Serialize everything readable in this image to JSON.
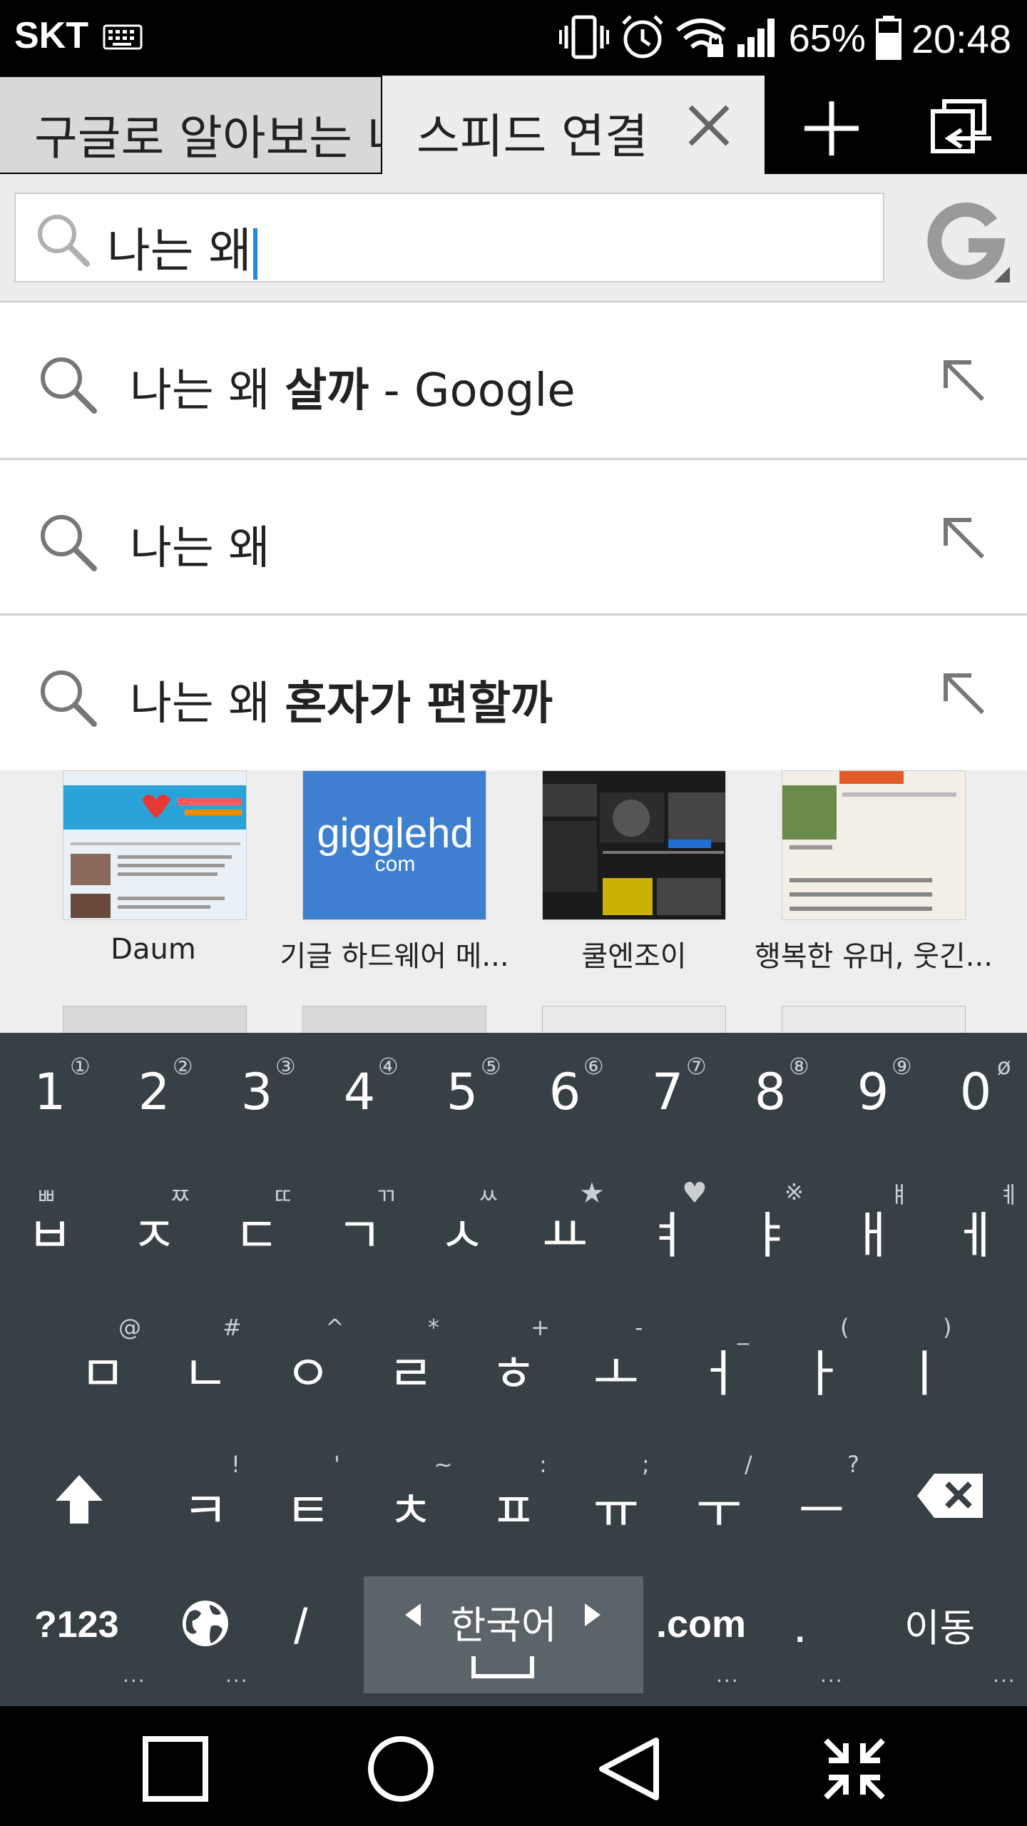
{
  "status_bar": {
    "carrier": "SKT",
    "battery_percent": "65%",
    "clock": "20:48",
    "icons": [
      "keyboard-icon",
      "vibrate-icon",
      "alarm-icon",
      "wifi-locked-icon",
      "signal-icon",
      "battery-icon"
    ]
  },
  "tabs": {
    "inactive_label": "구글로 알아보는 나",
    "active_label": "스피드 연결",
    "icons": [
      "close-icon",
      "plus-icon",
      "tab-manager-icon"
    ]
  },
  "address_bar": {
    "value": "나는 왜",
    "icons": [
      "search-icon",
      "google-g-icon"
    ]
  },
  "suggestions": [
    {
      "prefix": "나는 왜 ",
      "bold": "살까",
      "suffix": " - Google"
    },
    {
      "prefix": "나는 왜",
      "bold": "",
      "suffix": ""
    },
    {
      "prefix": "나는 왜 ",
      "bold": "혼자가 편할까",
      "suffix": ""
    }
  ],
  "speed_dial": {
    "tiles": [
      {
        "label": "Daum",
        "color": "#e9f1f7"
      },
      {
        "label": "기글 하드웨어 메...",
        "color": "#3f7fd0",
        "logo_text": "gigglehd",
        "logo_sub": "com"
      },
      {
        "label": "쿨엔조이",
        "color": "#1b1b1b"
      },
      {
        "label": "행복한 유머, 웃긴...",
        "color": "#f4efe6"
      }
    ]
  },
  "keyboard": {
    "number_row": [
      {
        "key": "1",
        "sup": "①"
      },
      {
        "key": "2",
        "sup": "②"
      },
      {
        "key": "3",
        "sup": "③"
      },
      {
        "key": "4",
        "sup": "④"
      },
      {
        "key": "5",
        "sup": "⑤"
      },
      {
        "key": "6",
        "sup": "⑥"
      },
      {
        "key": "7",
        "sup": "⑦"
      },
      {
        "key": "8",
        "sup": "⑧"
      },
      {
        "key": "9",
        "sup": "⑨"
      },
      {
        "key": "0",
        "sup": "ø"
      }
    ],
    "row1": [
      {
        "key": "ㅂ",
        "sup": "ㅃ"
      },
      {
        "key": "ㅈ",
        "sup": "ㅉ"
      },
      {
        "key": "ㄷ",
        "sup": "ㄸ"
      },
      {
        "key": "ㄱ",
        "sup": "ㄲ"
      },
      {
        "key": "ㅅ",
        "sup": "ㅆ"
      },
      {
        "key": "ㅛ",
        "sup": "★"
      },
      {
        "key": "ㅕ",
        "sup": "♥"
      },
      {
        "key": "ㅑ",
        "sup": "※"
      },
      {
        "key": "ㅐ",
        "sup": "ㅒ"
      },
      {
        "key": "ㅔ",
        "sup": "ㅖ"
      }
    ],
    "row2": [
      {
        "key": "ㅁ",
        "sup": "@"
      },
      {
        "key": "ㄴ",
        "sup": "#"
      },
      {
        "key": "ㅇ",
        "sup": "^"
      },
      {
        "key": "ㄹ",
        "sup": "*"
      },
      {
        "key": "ㅎ",
        "sup": "+"
      },
      {
        "key": "ㅗ",
        "sup": "-"
      },
      {
        "key": "ㅓ",
        "sup": "_"
      },
      {
        "key": "ㅏ",
        "sup": "("
      },
      {
        "key": "ㅣ",
        "sup": ")"
      }
    ],
    "row3": [
      {
        "key": "ㅋ",
        "sup": "!"
      },
      {
        "key": "ㅌ",
        "sup": "'"
      },
      {
        "key": "ㅊ",
        "sup": "~"
      },
      {
        "key": "ㅍ",
        "sup": ":"
      },
      {
        "key": "ㅠ",
        "sup": ";"
      },
      {
        "key": "ㅜ",
        "sup": "/"
      },
      {
        "key": "ㅡ",
        "sup": "?"
      }
    ],
    "symbols_key": "?123",
    "slash_key": "/",
    "language_label": "한국어",
    "dotcom_key": ".com",
    "period_key": ".",
    "enter_key": "이동",
    "more_dots": "...",
    "icons": [
      "shift-icon",
      "backspace-icon",
      "globe-icon",
      "arrow-left-icon",
      "arrow-right-icon",
      "space-icon"
    ]
  },
  "nav_bar": {
    "icons": [
      "recents-icon",
      "home-icon",
      "back-icon",
      "split-screen-icon"
    ]
  }
}
